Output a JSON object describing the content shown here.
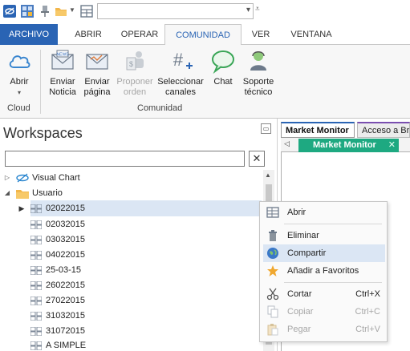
{
  "quick_access": {
    "combo_value": "",
    "icons": [
      "app-logo-icon",
      "workspace-icon",
      "pin-icon",
      "folder-icon",
      "dropdown-icon",
      "layout-icon",
      "customize-icon"
    ]
  },
  "ribbon_tabs": [
    {
      "label": "ARCHIVO"
    },
    {
      "label": "ABRIR"
    },
    {
      "label": "OPERAR"
    },
    {
      "label": "COMUNIDAD"
    },
    {
      "label": "VER"
    },
    {
      "label": "VENTANA"
    }
  ],
  "ribbon": {
    "cloud_group": {
      "open_label": "Abrir",
      "group_label": "Cloud"
    },
    "community_group": {
      "send_news_label_1": "Enviar",
      "send_news_label_2": "Noticia",
      "send_page_label_1": "Enviar",
      "send_page_label_2": "página",
      "propose_order_label_1": "Proponer",
      "propose_order_label_2": "orden",
      "select_channels_label_1": "Seleccionar",
      "select_channels_label_2": "canales",
      "chat_label": "Chat",
      "support_label_1": "Soporte",
      "support_label_2": "técnico",
      "group_label": "Comunidad",
      "news_badge": "NEWS"
    }
  },
  "workspaces": {
    "title": "Workspaces",
    "search_value": "",
    "tree": [
      {
        "label": "Visual Chart"
      },
      {
        "label": "Usuario"
      },
      {
        "label": "02022015"
      },
      {
        "label": "02032015"
      },
      {
        "label": "03032015"
      },
      {
        "label": "04022015"
      },
      {
        "label": "25-03-15"
      },
      {
        "label": "26022015"
      },
      {
        "label": "27022015"
      },
      {
        "label": "31032015"
      },
      {
        "label": "31072015"
      },
      {
        "label": "A SIMPLE"
      }
    ]
  },
  "documents": {
    "tabs": [
      {
        "label": "Market Monitor"
      },
      {
        "label": "Acceso a Br"
      }
    ],
    "inner_tab": "Market Monitor"
  },
  "context_menu": {
    "items": [
      {
        "label": "Abrir",
        "shortcut": ""
      },
      {
        "label": "Eliminar",
        "shortcut": ""
      },
      {
        "label": "Compartir",
        "shortcut": ""
      },
      {
        "label": "Añadir a Favoritos",
        "shortcut": ""
      },
      {
        "label": "Cortar",
        "shortcut": "Ctrl+X"
      },
      {
        "label": "Copiar",
        "shortcut": "Ctrl+C"
      },
      {
        "label": "Pegar",
        "shortcut": "Ctrl+V"
      }
    ]
  },
  "colors": {
    "accent": "#2a64b4",
    "monitor_tab": "#1ea981",
    "selection": "#dbe6f4"
  }
}
